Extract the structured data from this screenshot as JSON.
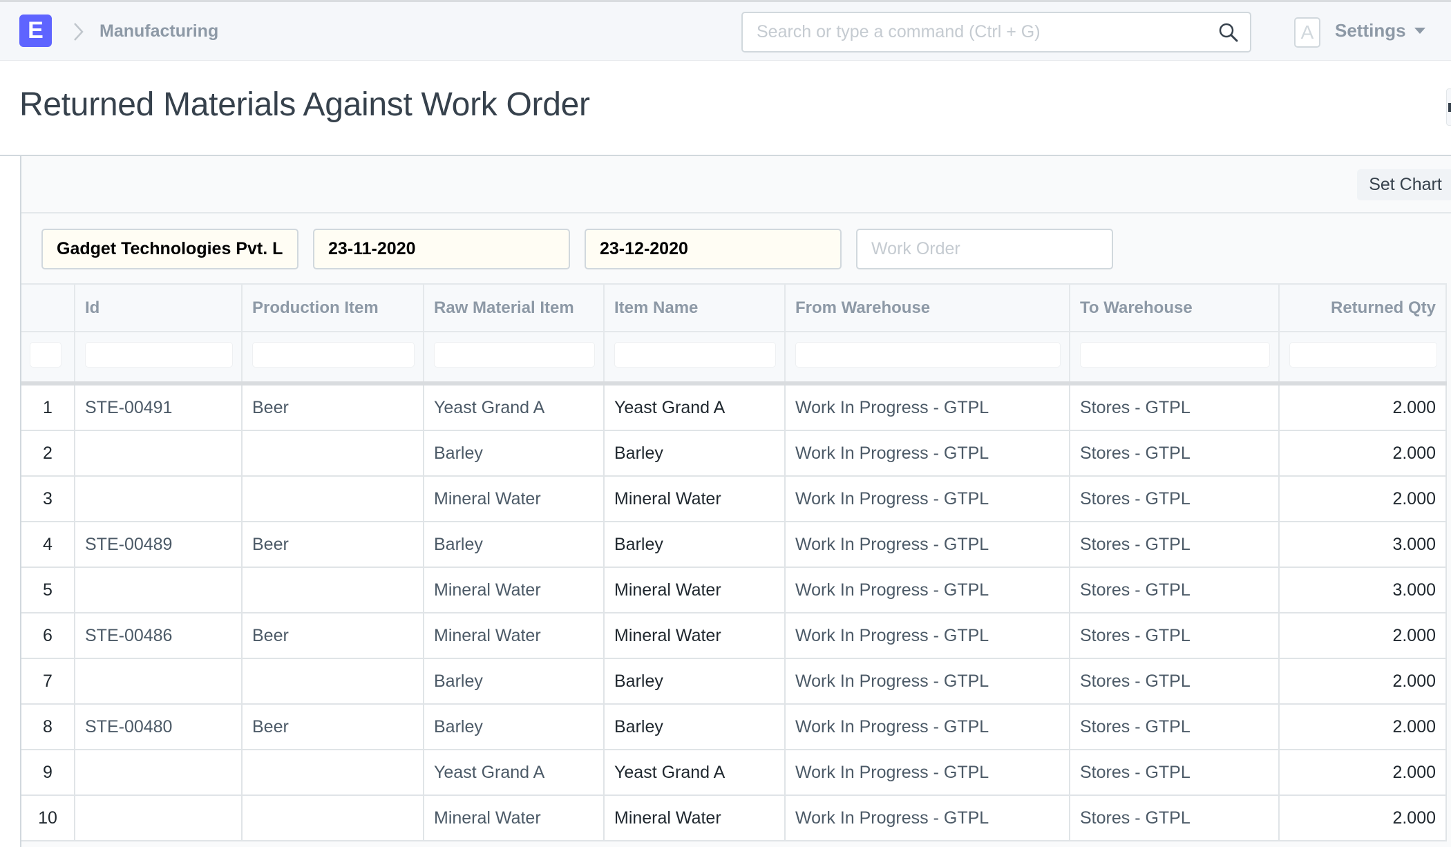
{
  "app": {
    "logo_letter": "E",
    "breadcrumb": "Manufacturing",
    "search_placeholder": "Search or type a command (Ctrl + G)",
    "avatar_letter": "A",
    "settings_label": "Settings"
  },
  "page": {
    "title": "Returned Materials Against Work Order",
    "set_chart_label": "Set Chart"
  },
  "filters": {
    "company": "Gadget Technologies Pvt. L",
    "from_date": "23-11-2020",
    "to_date": "23-12-2020",
    "work_order_placeholder": "Work Order"
  },
  "table": {
    "columns": [
      "",
      "Id",
      "Production Item",
      "Raw Material Item",
      "Item Name",
      "From Warehouse",
      "To Warehouse",
      "Returned Qty"
    ],
    "rows": [
      [
        "1",
        "STE-00491",
        "Beer",
        "Yeast Grand A",
        "Yeast Grand A",
        "Work In Progress - GTPL",
        "Stores - GTPL",
        "2.000"
      ],
      [
        "2",
        "",
        "",
        "Barley",
        "Barley",
        "Work In Progress - GTPL",
        "Stores - GTPL",
        "2.000"
      ],
      [
        "3",
        "",
        "",
        "Mineral Water",
        "Mineral Water",
        "Work In Progress - GTPL",
        "Stores - GTPL",
        "2.000"
      ],
      [
        "4",
        "STE-00489",
        "Beer",
        "Barley",
        "Barley",
        "Work In Progress - GTPL",
        "Stores - GTPL",
        "3.000"
      ],
      [
        "5",
        "",
        "",
        "Mineral Water",
        "Mineral Water",
        "Work In Progress - GTPL",
        "Stores - GTPL",
        "3.000"
      ],
      [
        "6",
        "STE-00486",
        "Beer",
        "Mineral Water",
        "Mineral Water",
        "Work In Progress - GTPL",
        "Stores - GTPL",
        "2.000"
      ],
      [
        "7",
        "",
        "",
        "Barley",
        "Barley",
        "Work In Progress - GTPL",
        "Stores - GTPL",
        "2.000"
      ],
      [
        "8",
        "STE-00480",
        "Beer",
        "Barley",
        "Barley",
        "Work In Progress - GTPL",
        "Stores - GTPL",
        "2.000"
      ],
      [
        "9",
        "",
        "",
        "Yeast Grand A",
        "Yeast Grand A",
        "Work In Progress - GTPL",
        "Stores - GTPL",
        "2.000"
      ],
      [
        "10",
        "",
        "",
        "Mineral Water",
        "Mineral Water",
        "Work In Progress - GTPL",
        "Stores - GTPL",
        "2.000"
      ]
    ]
  },
  "colors": {
    "brand": "#5e64ff",
    "filled_filter_bg": "#fffdf4"
  }
}
